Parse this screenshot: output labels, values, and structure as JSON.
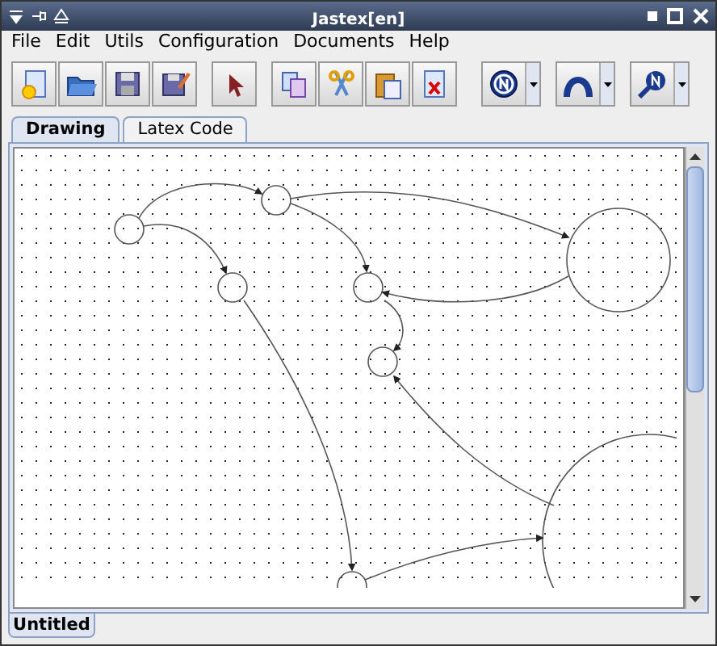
{
  "window": {
    "title": "Jastex[en]"
  },
  "menu": [
    "File",
    "Edit",
    "Utils",
    "Configuration",
    "Documents",
    "Help"
  ],
  "tabs": [
    {
      "label": "Drawing",
      "selected": true
    },
    {
      "label": "Latex Code",
      "selected": false
    }
  ],
  "document_tabs": [
    {
      "label": "Untitled",
      "selected": true
    }
  ]
}
